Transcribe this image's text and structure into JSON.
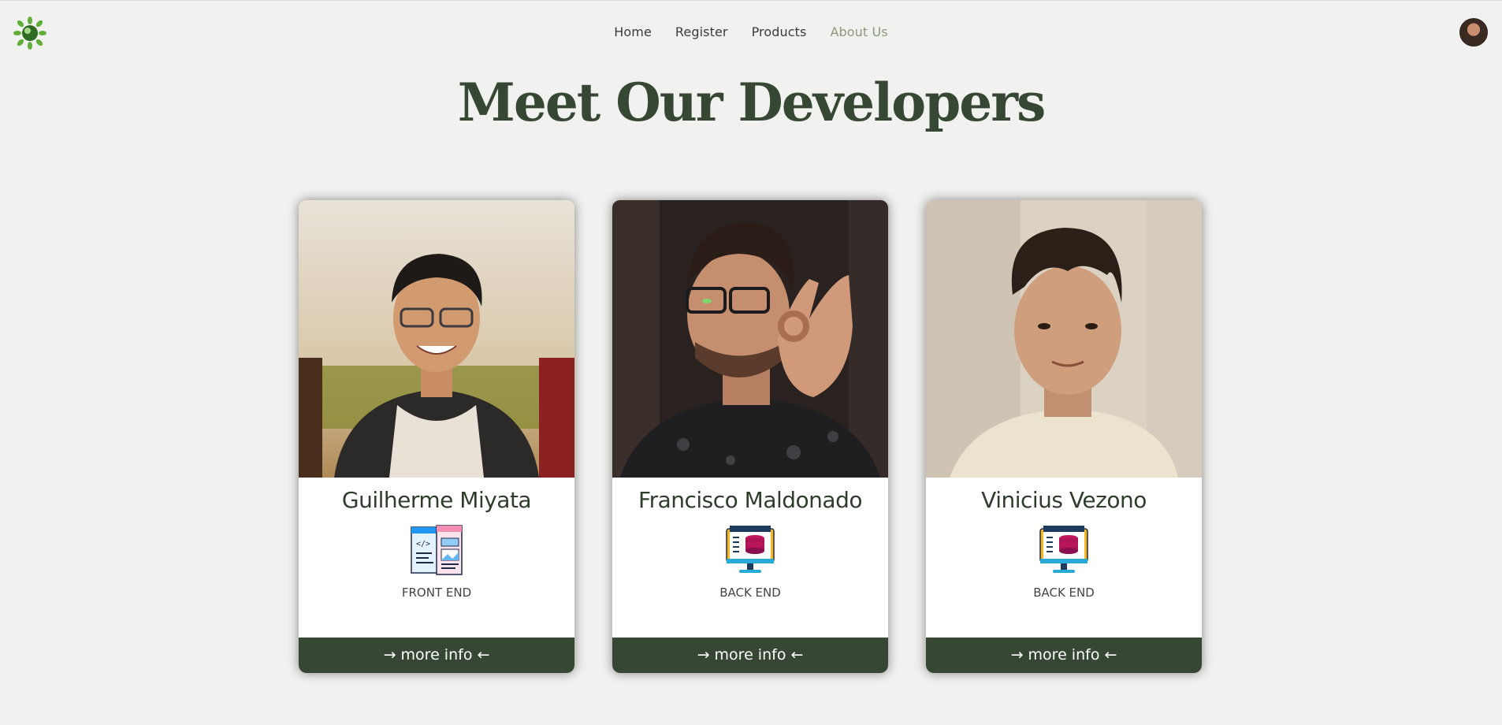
{
  "nav": {
    "items": [
      "Home",
      "Register",
      "Products",
      "About Us"
    ],
    "active": "About Us"
  },
  "page": {
    "title": "Meet Our Developers"
  },
  "developers": [
    {
      "name": "Guilherme Miyata",
      "role": "FRONT END",
      "role_icon": "frontend-code-icon",
      "more": "→ more info ←"
    },
    {
      "name": "Francisco Maldonado",
      "role": "BACK END",
      "role_icon": "database-monitor-icon",
      "more": "→ more info ←"
    },
    {
      "name": "Vinicius Vezono",
      "role": "BACK END",
      "role_icon": "database-monitor-icon",
      "more": "→ more info ←"
    }
  ],
  "colors": {
    "background": "#f1f1ef",
    "brand_green": "#364733",
    "active_nav": "#8a9a7b"
  }
}
